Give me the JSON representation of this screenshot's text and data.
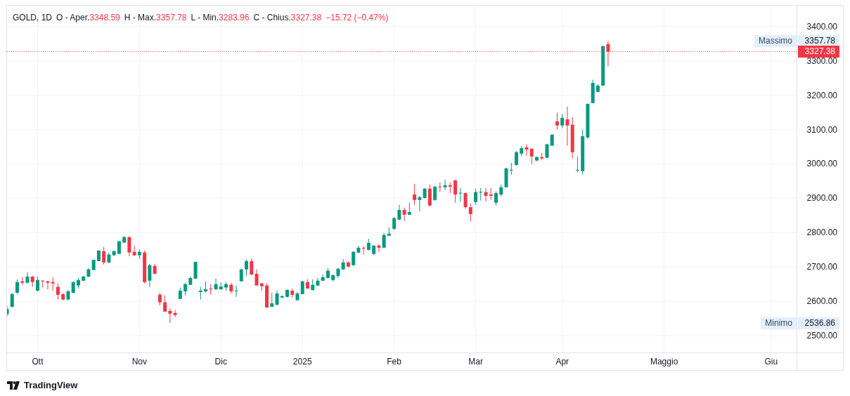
{
  "legend": {
    "symbol": "GOLD, 1D",
    "fields": [
      {
        "label": "O - Aper.",
        "value": "3348.59"
      },
      {
        "label": "H - Max.",
        "value": "3357.78"
      },
      {
        "label": "L - Min.",
        "value": "3283.96"
      },
      {
        "label": "C - Chius.",
        "value": "3327.38"
      }
    ],
    "change": "−15.72 (−0.47%)"
  },
  "price_labels": [
    {
      "label": "Massimo",
      "value": "3357.78"
    },
    {
      "label": "Minimo",
      "value": "2536.86"
    }
  ],
  "chart_data": {
    "type": "candlestick",
    "grid": true,
    "ylim": [
      2451,
      3461
    ],
    "yticks": [
      {
        "value": 2500,
        "label": "2500.00"
      },
      {
        "value": 2600,
        "label": "2600.00"
      },
      {
        "value": 2700,
        "label": "2700.00"
      },
      {
        "value": 2800,
        "label": "2800.00"
      },
      {
        "value": 2900,
        "label": "2900.00"
      },
      {
        "value": 3000,
        "label": "3000.00"
      },
      {
        "value": 3100,
        "label": "3100.00"
      },
      {
        "value": 3200,
        "label": "3200.00"
      },
      {
        "value": 3300,
        "label": "3300.00"
      },
      {
        "value": 3400,
        "label": "3400.00"
      }
    ],
    "ref_lines": [
      {
        "axis": "y",
        "value": 3327.38,
        "color": "#f23645",
        "label": "3327.38"
      }
    ],
    "categories": [
      null,
      null,
      null,
      null,
      null,
      null,
      "Ott",
      null,
      null,
      null,
      null,
      null,
      null,
      null,
      null,
      null,
      null,
      null,
      null,
      null,
      null,
      null,
      null,
      null,
      null,
      null,
      "Nov",
      null,
      null,
      null,
      null,
      null,
      null,
      null,
      null,
      null,
      null,
      null,
      null,
      null,
      null,
      null,
      "Dic",
      null,
      null,
      null,
      null,
      null,
      null,
      null,
      null,
      null,
      null,
      null,
      null,
      null,
      null,
      null,
      "2025",
      null,
      null,
      null,
      null,
      null,
      null,
      null,
      null,
      null,
      null,
      null,
      null,
      null,
      null,
      null,
      null,
      null,
      "Feb",
      null,
      null,
      null,
      null,
      null,
      null,
      null,
      null,
      null,
      null,
      null,
      null,
      null,
      null,
      null,
      "Mar",
      null,
      null,
      null,
      null,
      null,
      null,
      null,
      null,
      null,
      null,
      null,
      null,
      null,
      null,
      null,
      null,
      "Apr",
      null,
      null,
      null,
      null,
      null,
      null,
      null,
      null,
      null,
      null,
      null,
      null,
      null,
      null,
      null,
      null,
      null,
      null,
      null,
      "Maggio",
      null,
      null,
      null,
      null,
      null,
      null,
      null,
      null,
      null,
      null,
      null,
      null,
      null,
      null,
      null,
      null,
      null,
      null,
      null,
      null,
      "Giu",
      null,
      null,
      null,
      null
    ],
    "ohlc": [
      [
        2562,
        2586,
        2556,
        2578
      ],
      [
        2584,
        2625,
        2582,
        2621
      ],
      [
        2625,
        2664,
        2621,
        2656
      ],
      [
        2658,
        2670,
        2648,
        2654
      ],
      [
        2654,
        2685,
        2652,
        2672
      ],
      [
        2672,
        2674,
        2642,
        2656
      ],
      [
        2631,
        2672,
        2629,
        2662
      ],
      [
        2660,
        2662,
        2640,
        2658
      ],
      [
        2658,
        2660,
        2635,
        2654
      ],
      [
        2656,
        2670,
        2631,
        2652
      ],
      [
        2642,
        2652,
        2605,
        2619
      ],
      [
        2621,
        2623,
        2603,
        2605
      ],
      [
        2605,
        2633,
        2603,
        2629
      ],
      [
        2625,
        2658,
        2623,
        2656
      ],
      [
        2646,
        2668,
        2637,
        2662
      ],
      [
        2660,
        2674,
        2658,
        2672
      ],
      [
        2672,
        2697,
        2670,
        2693
      ],
      [
        2691,
        2721,
        2691,
        2721
      ],
      [
        2717,
        2748,
        2717,
        2748
      ],
      [
        2746,
        2758,
        2707,
        2713
      ],
      [
        2713,
        2742,
        2711,
        2736
      ],
      [
        2734,
        2748,
        2732,
        2746
      ],
      [
        2738,
        2775,
        2738,
        2775
      ],
      [
        2771,
        2789,
        2771,
        2787
      ],
      [
        2787,
        2789,
        2731,
        2742
      ],
      [
        2744,
        2762,
        2732,
        2734
      ],
      [
        2734,
        2750,
        2723,
        2744
      ],
      [
        2742,
        2748,
        2652,
        2656
      ],
      [
        2660,
        2709,
        2642,
        2705
      ],
      [
        2703,
        2709,
        2680,
        2680
      ],
      [
        2619,
        2625,
        2588,
        2597
      ],
      [
        2597,
        2617,
        2570,
        2570
      ],
      [
        2572,
        2580,
        2537,
        2564
      ],
      [
        2566,
        2574,
        2554,
        2560
      ],
      [
        2607,
        2640,
        2607,
        2631
      ],
      [
        2629,
        2654,
        2617,
        2650
      ],
      [
        2648,
        2672,
        2648,
        2668
      ],
      [
        2666,
        2715,
        2666,
        2715
      ],
      [
        2627,
        2642,
        2605,
        2631
      ],
      [
        2629,
        2658,
        2625,
        2635
      ],
      [
        2637,
        2650,
        2619,
        2635
      ],
      [
        2635,
        2666,
        2633,
        2650
      ],
      [
        2635,
        2654,
        2633,
        2643
      ],
      [
        2640,
        2656,
        2631,
        2650
      ],
      [
        2648,
        2654,
        2623,
        2629
      ],
      [
        2630,
        2646,
        2613,
        2632
      ],
      [
        2658,
        2695,
        2658,
        2693
      ],
      [
        2693,
        2721,
        2674,
        2717
      ],
      [
        2717,
        2725,
        2676,
        2678
      ],
      [
        2680,
        2693,
        2646,
        2646
      ],
      [
        2652,
        2654,
        2631,
        2644
      ],
      [
        2646,
        2652,
        2582,
        2582
      ],
      [
        2584,
        2625,
        2584,
        2594
      ],
      [
        2590,
        2631,
        2588,
        2623
      ],
      [
        2611,
        2617,
        2609,
        2615
      ],
      [
        2613,
        2635,
        2611,
        2633
      ],
      [
        2631,
        2637,
        2611,
        2619
      ],
      [
        2603,
        2627,
        2603,
        2623
      ],
      [
        2621,
        2660,
        2621,
        2658
      ],
      [
        2656,
        2664,
        2637,
        2637
      ],
      [
        2633,
        2664,
        2631,
        2648
      ],
      [
        2646,
        2668,
        2644,
        2660
      ],
      [
        2660,
        2678,
        2658,
        2670
      ],
      [
        2668,
        2697,
        2666,
        2689
      ],
      [
        2662,
        2678,
        2658,
        2676
      ],
      [
        2674,
        2697,
        2668,
        2695
      ],
      [
        2693,
        2723,
        2691,
        2713
      ],
      [
        2713,
        2717,
        2699,
        2701
      ],
      [
        2705,
        2746,
        2703,
        2744
      ],
      [
        2742,
        2762,
        2740,
        2756
      ],
      [
        2756,
        2760,
        2736,
        2754
      ],
      [
        2750,
        2782,
        2748,
        2770
      ],
      [
        2738,
        2764,
        2734,
        2762
      ],
      [
        2762,
        2766,
        2744,
        2756
      ],
      [
        2756,
        2799,
        2756,
        2793
      ],
      [
        2791,
        2815,
        2791,
        2797
      ],
      [
        2811,
        2846,
        2807,
        2842
      ],
      [
        2838,
        2881,
        2836,
        2866
      ],
      [
        2866,
        2873,
        2834,
        2852
      ],
      [
        2852,
        2887,
        2852,
        2860
      ],
      [
        2911,
        2942,
        2881,
        2895
      ],
      [
        2895,
        2907,
        2862,
        2903
      ],
      [
        2901,
        2930,
        2899,
        2928
      ],
      [
        2928,
        2940,
        2875,
        2879
      ],
      [
        2895,
        2936,
        2893,
        2934
      ],
      [
        2934,
        2946,
        2918,
        2932
      ],
      [
        2932,
        2954,
        2924,
        2938
      ],
      [
        2938,
        2946,
        2915,
        2934
      ],
      [
        2952,
        2954,
        2887,
        2911
      ],
      [
        2914,
        2930,
        2889,
        2916
      ],
      [
        2915,
        2917,
        2869,
        2874
      ],
      [
        2874,
        2885,
        2832,
        2854
      ],
      [
        2889,
        2928,
        2881,
        2918
      ],
      [
        2917,
        2930,
        2893,
        2919
      ],
      [
        2918,
        2930,
        2891,
        2907
      ],
      [
        2911,
        2930,
        2895,
        2907
      ],
      [
        2887,
        2920,
        2879,
        2915
      ],
      [
        2911,
        2940,
        2905,
        2932
      ],
      [
        2932,
        2989,
        2932,
        2987
      ],
      [
        2981,
        3003,
        2969,
        2983
      ],
      [
        2997,
        3038,
        2995,
        3034
      ],
      [
        3030,
        3052,
        3022,
        3046
      ],
      [
        3048,
        3057,
        3024,
        3042
      ],
      [
        3044,
        3046,
        2999,
        3022
      ],
      [
        3010,
        3022,
        3008,
        3020
      ],
      [
        3020,
        3032,
        3012,
        3016
      ],
      [
        3018,
        3059,
        3018,
        3057
      ],
      [
        3053,
        3087,
        3053,
        3085
      ],
      [
        3124,
        3149,
        3100,
        3112
      ],
      [
        3112,
        3145,
        3104,
        3134
      ],
      [
        3130,
        3167,
        3053,
        3112
      ],
      [
        3114,
        3136,
        3016,
        3034
      ],
      [
        2981,
        3022,
        2975,
        2983
      ],
      [
        2979,
        3100,
        2969,
        3081
      ],
      [
        3077,
        3175,
        3073,
        3175
      ],
      [
        3177,
        3245,
        3177,
        3236
      ],
      [
        3210,
        3232,
        3208,
        3228
      ],
      [
        3228,
        3345,
        3228,
        3343
      ],
      [
        3349,
        3358,
        3284,
        3327
      ],
      null,
      null,
      null,
      null,
      null,
      null,
      null,
      null,
      null,
      null,
      null,
      null,
      null,
      null,
      null,
      null,
      null,
      null,
      null,
      null,
      null,
      null,
      null,
      null,
      null,
      null,
      null,
      null,
      null,
      null,
      null,
      null,
      null,
      null,
      null,
      null
    ]
  },
  "footer": {
    "brand": "TradingView"
  }
}
